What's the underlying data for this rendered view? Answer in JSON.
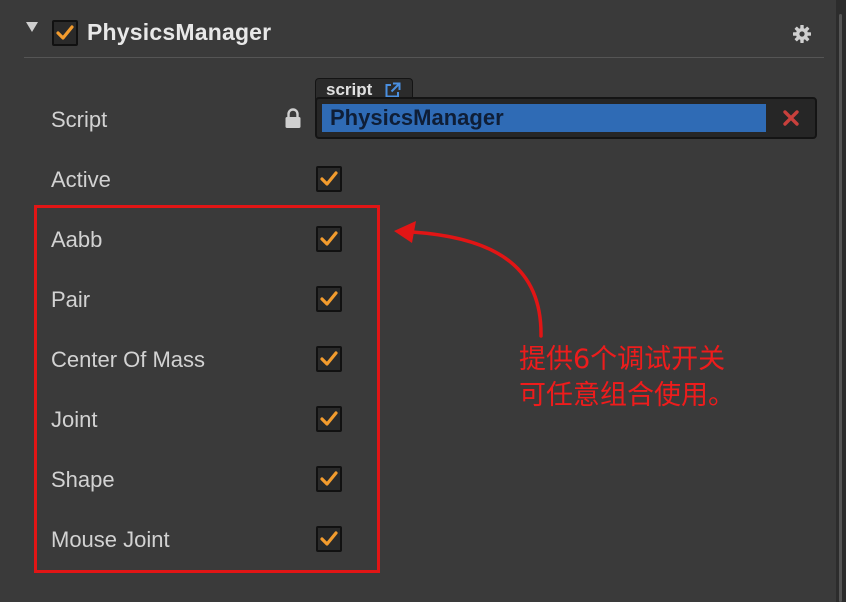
{
  "component": {
    "title": "PhysicsManager",
    "enabled": true
  },
  "script": {
    "label": "Script",
    "tab_label": "script",
    "value": "PhysicsManager"
  },
  "properties": [
    {
      "label": "Active",
      "checked": true
    },
    {
      "label": "Aabb",
      "checked": true
    },
    {
      "label": "Pair",
      "checked": true
    },
    {
      "label": "Center Of Mass",
      "checked": true
    },
    {
      "label": "Joint",
      "checked": true
    },
    {
      "label": "Shape",
      "checked": true
    },
    {
      "label": "Mouse Joint",
      "checked": true
    }
  ],
  "annotation": {
    "line1": "提供6个调试开关",
    "line2": "可任意组合使用。"
  },
  "colors": {
    "panel_bg": "#3a3a3a",
    "check_orange": "#f39c2e",
    "highlight_red": "#e11515",
    "script_blue": "#2f6bb5",
    "clear_red": "#c8403c"
  },
  "icons": [
    "fold-arrow-icon",
    "check-icon",
    "gear-icon",
    "lock-icon",
    "external-link-icon",
    "clear-icon"
  ]
}
